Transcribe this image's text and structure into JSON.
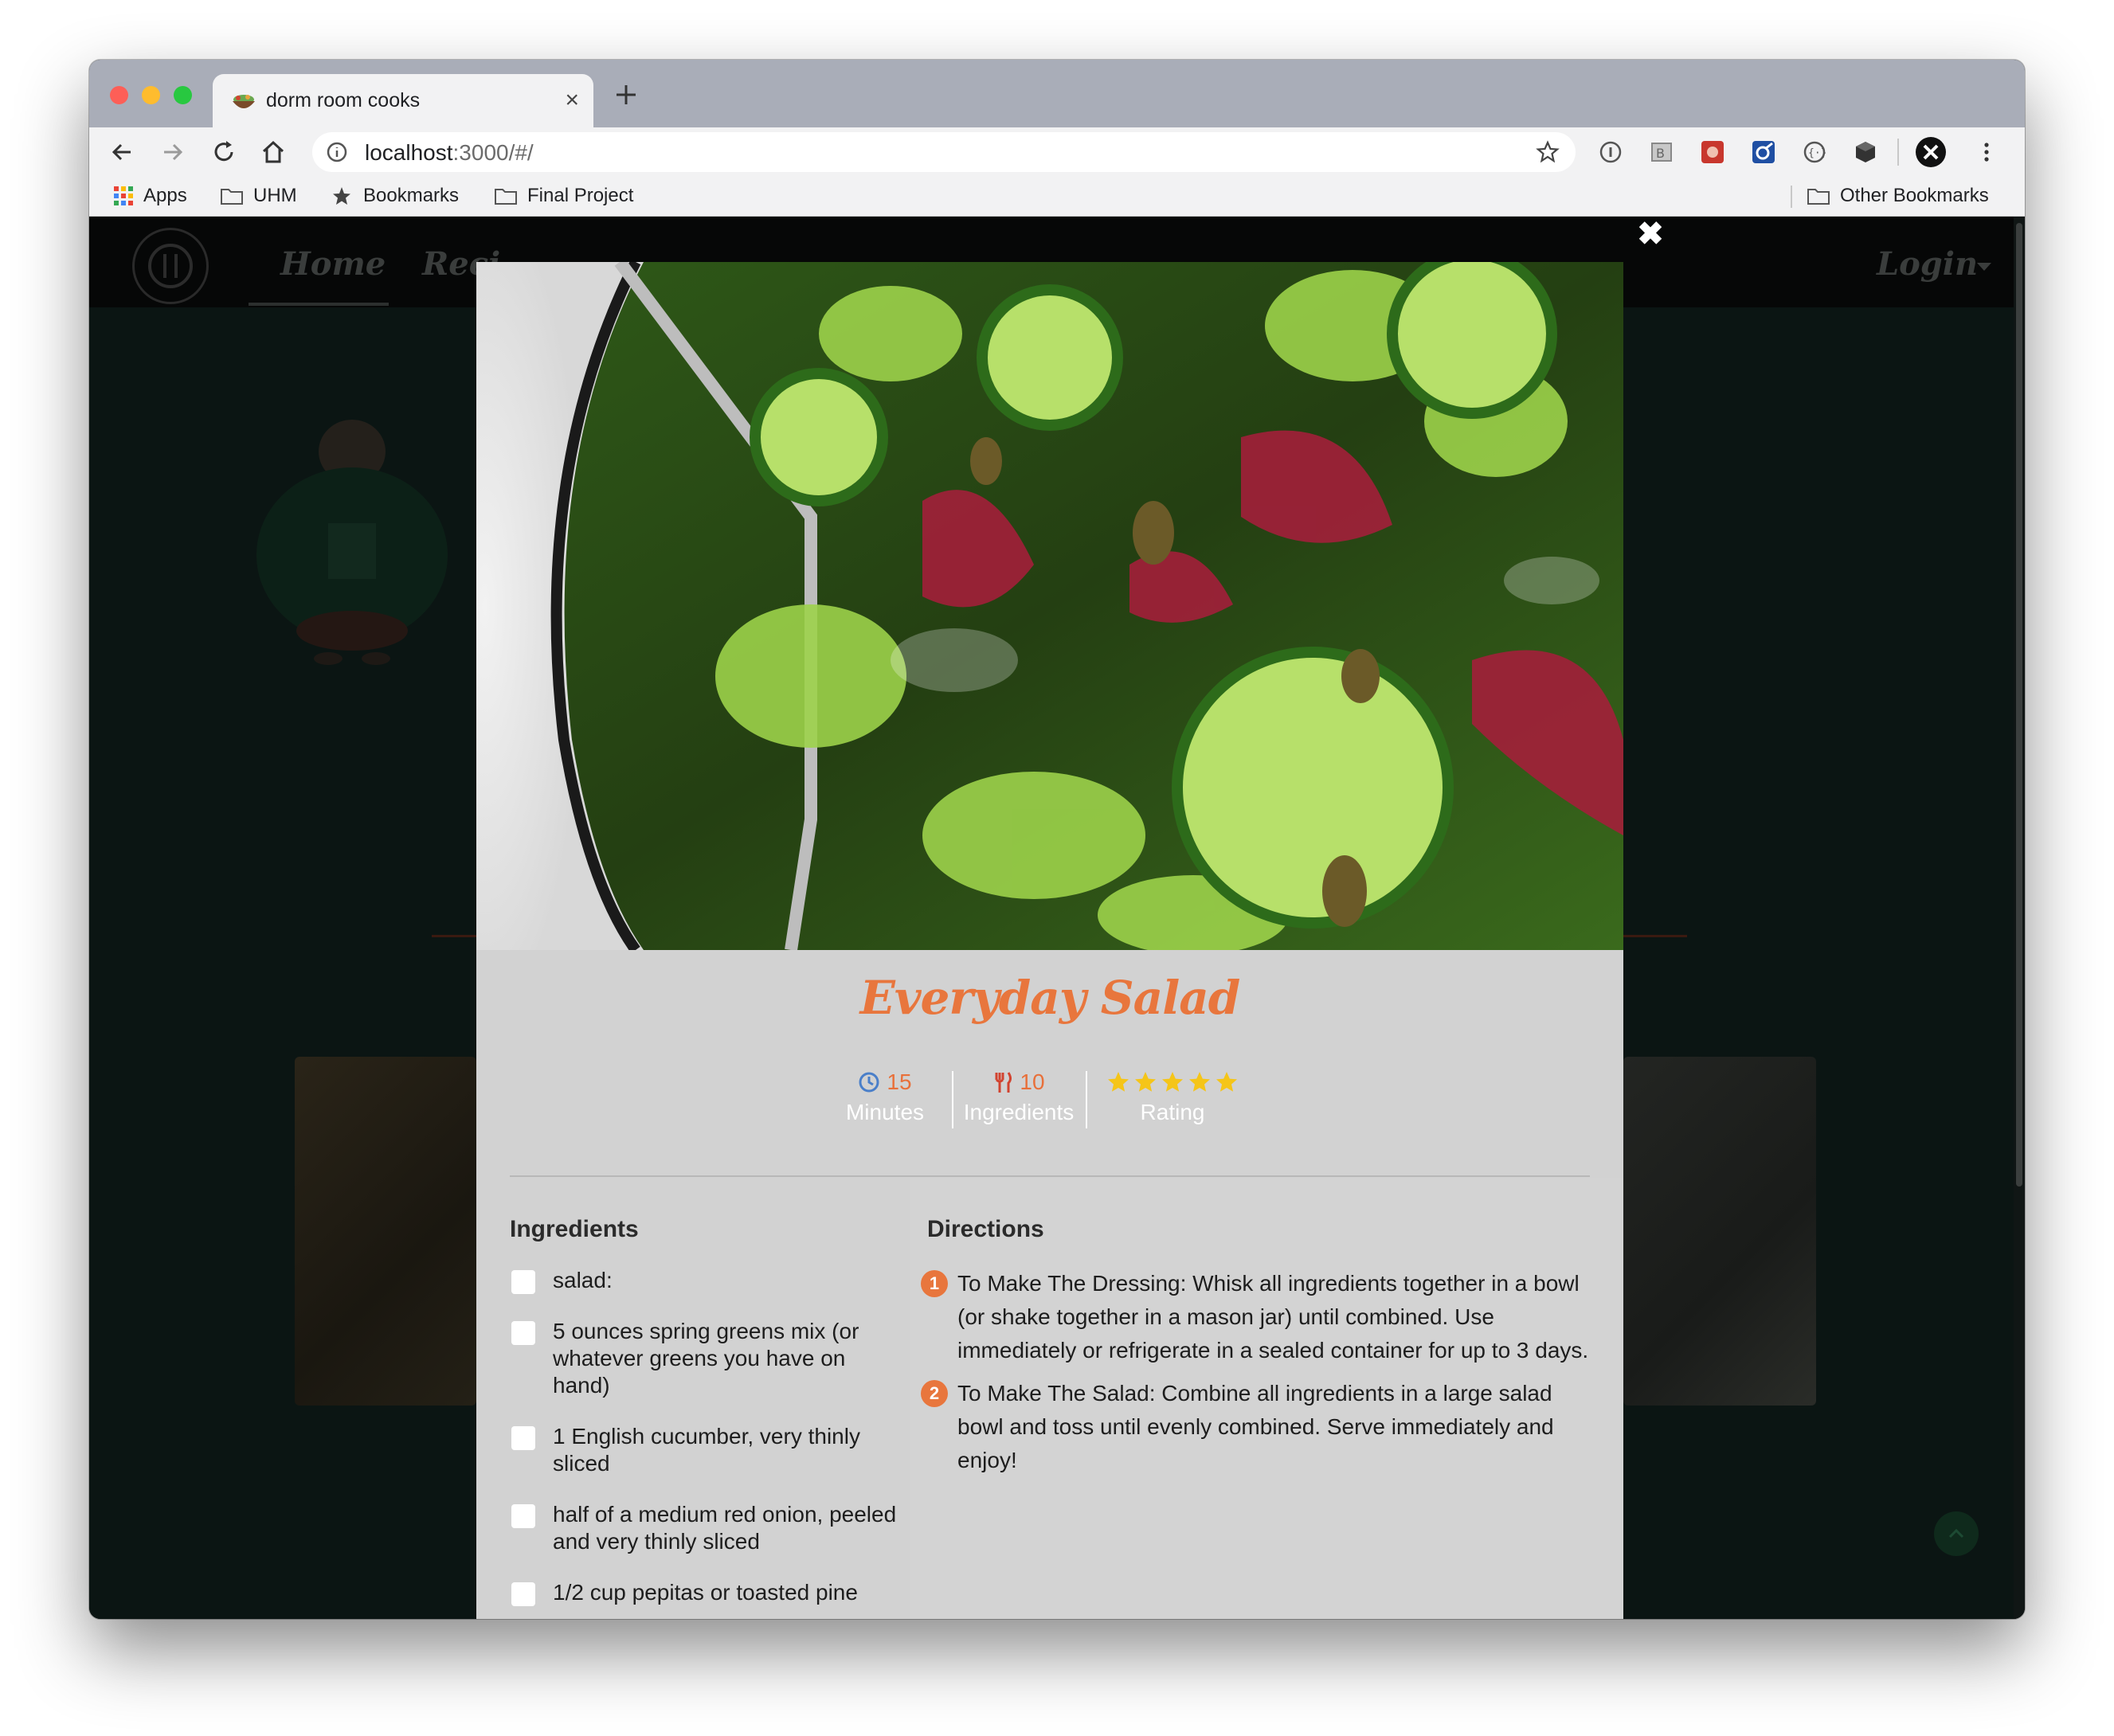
{
  "browser": {
    "tab_title": "dorm room cooks",
    "url_host": "localhost",
    "url_rest": ":3000/#/",
    "bookmarks": [
      "Apps",
      "UHM",
      "Bookmarks",
      "Final Project"
    ],
    "other_bookmarks": "Other Bookmarks"
  },
  "site": {
    "nav": [
      "Home",
      "Reci",
      "Login"
    ],
    "close_symbol": "✖"
  },
  "recipe": {
    "title": "Everyday Salad",
    "stats": [
      {
        "value": "15",
        "label": "Minutes",
        "icon": "clock-icon",
        "color": "#4a7fc9"
      },
      {
        "value": "10",
        "label": "Ingredients",
        "icon": "utensils-icon",
        "color": "#d2432f"
      },
      {
        "value": "",
        "label": "Rating",
        "icon": "star-icon",
        "rating": 5,
        "color": "#f5c518"
      }
    ],
    "ingredients_heading": "Ingredients",
    "ingredients": [
      "salad:",
      "5 ounces spring greens mix (or whatever greens you have on hand)",
      "1 English cucumber, very thinly sliced",
      "half of a medium red onion, peeled and very thinly sliced",
      "1/2 cup pepitas or toasted pine"
    ],
    "directions_heading": "Directions",
    "directions": [
      {
        "num": "1",
        "text": "To Make The Dressing: Whisk all ingredients together in a bowl (or shake together in a mason jar) until combined. Use immediately or refrigerate in a sealed container for up to 3 days."
      },
      {
        "num": "2",
        "text": "To Make The Salad: Combine all ingredients in a large salad bowl and toss until evenly combined. Serve immediately and enjoy!"
      }
    ]
  },
  "colors": {
    "accent": "#e8763d",
    "modal_bg": "#d2d2d2",
    "page_bg": "#0b1513"
  }
}
